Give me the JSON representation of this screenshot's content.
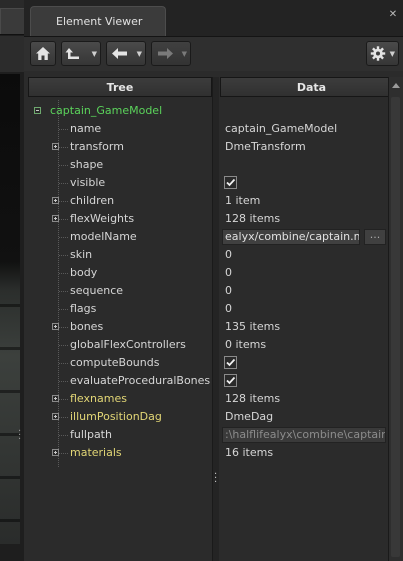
{
  "window": {
    "title": "Element Viewer"
  },
  "toolbar": {
    "home": "home-icon",
    "up": "up-arrow-icon",
    "back": "back-arrow-icon",
    "forward": "forward-arrow-icon",
    "settings": "gear-icon"
  },
  "columns": {
    "tree": "Tree",
    "data": "Data"
  },
  "rows": [
    {
      "name": "captain_GameModel",
      "data": "",
      "kind": "text",
      "expander": "minus",
      "root": true
    },
    {
      "name": "name",
      "data": "captain_GameModel",
      "kind": "text",
      "expander": ""
    },
    {
      "name": "transform",
      "data": "DmeTransform",
      "kind": "text",
      "expander": "plus"
    },
    {
      "name": "shape",
      "data": "",
      "kind": "text",
      "expander": ""
    },
    {
      "name": "visible",
      "data": "",
      "kind": "check",
      "checked": true,
      "expander": ""
    },
    {
      "name": "children",
      "data": "1 item",
      "kind": "text",
      "expander": "plus"
    },
    {
      "name": "flexWeights",
      "data": "128 items",
      "kind": "text",
      "expander": "plus"
    },
    {
      "name": "modelName",
      "data": "ealyx/combine/captain.mdl",
      "kind": "field",
      "browse": "...",
      "expander": ""
    },
    {
      "name": "skin",
      "data": "0",
      "kind": "text",
      "expander": ""
    },
    {
      "name": "body",
      "data": "0",
      "kind": "text",
      "expander": ""
    },
    {
      "name": "sequence",
      "data": "0",
      "kind": "text",
      "expander": ""
    },
    {
      "name": "flags",
      "data": "0",
      "kind": "text",
      "expander": ""
    },
    {
      "name": "bones",
      "data": "135 items",
      "kind": "text",
      "expander": "plus"
    },
    {
      "name": "globalFlexControllers",
      "data": "0 items",
      "kind": "text",
      "expander": ""
    },
    {
      "name": "computeBounds",
      "data": "",
      "kind": "check",
      "checked": true,
      "expander": ""
    },
    {
      "name": "evaluateProceduralBones",
      "data": "",
      "kind": "check",
      "checked": true,
      "expander": ""
    },
    {
      "name": "flexnames",
      "data": "128 items",
      "kind": "text",
      "expander": "plus",
      "highlight": true
    },
    {
      "name": "illumPositionDag",
      "data": "DmeDag",
      "kind": "text",
      "expander": "plus",
      "highlight": true
    },
    {
      "name": "fullpath",
      "data": ":\\halflifealyx\\combine\\captain.mdl",
      "kind": "field-dim",
      "expander": ""
    },
    {
      "name": "materials",
      "data": "16 items",
      "kind": "text",
      "expander": "plus",
      "highlight": true
    }
  ]
}
